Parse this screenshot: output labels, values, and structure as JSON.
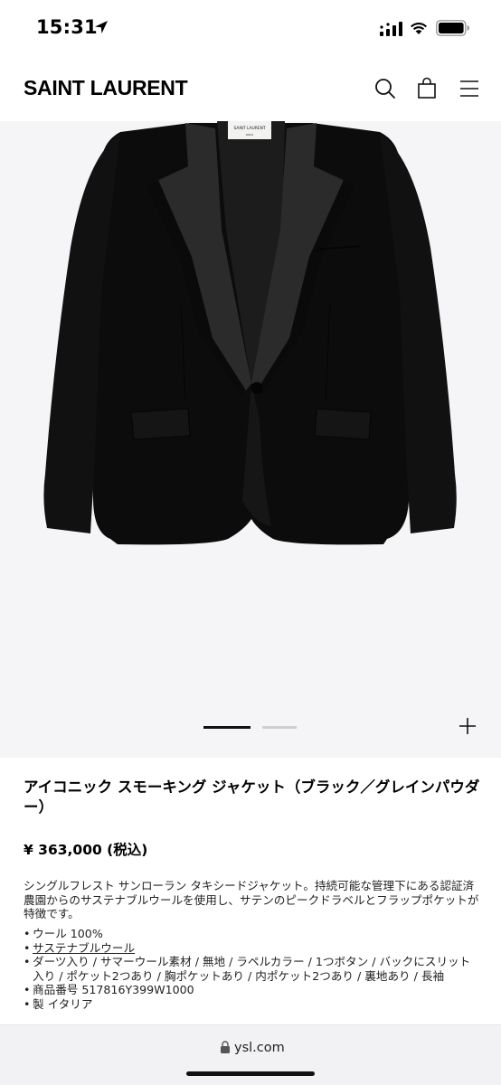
{
  "status_bar": {
    "time": "15:31"
  },
  "header": {
    "logo": "SAINT LAURENT",
    "icons": [
      "search-icon",
      "shopping-bag-icon",
      "hamburger-menu-icon"
    ]
  },
  "gallery": {
    "image": "black-tuxedo-jacket",
    "label_brand": "SAINT LAURENT",
    "label_city": "PARIS",
    "current_image": 1,
    "total_images": 2,
    "zoom_icon": "plus-icon"
  },
  "product": {
    "title": "アイコニック スモーキング ジャケット（ブラック／グレインパウダー）",
    "price": "¥ 363,000 (税込)",
    "description": "シングルフレスト サンローラン タキシードジャケット。持続可能な管理下にある認証済農園からのサステナブルウールを使用し、サテンのピークドラベルとフラップポケットが特徴です。",
    "specs": [
      "ウール 100%",
      "サステナブルウール",
      "ダーツ入り / サマーウール素材 / 無地 / ラペルカラー / 1つボタン / バックにスリット入り / ポケット2つあり / 胸ポケットあり / 内ポケット2つあり / 裏地あり / 長袖",
      "商品番号 517816Y399W1000",
      "製 イタリア"
    ]
  },
  "browser": {
    "url": "ysl.com"
  },
  "colors": {
    "accent": "#000000",
    "gallery_bg": "#f5f4f7",
    "browser_bar": "#f2f2f4"
  }
}
